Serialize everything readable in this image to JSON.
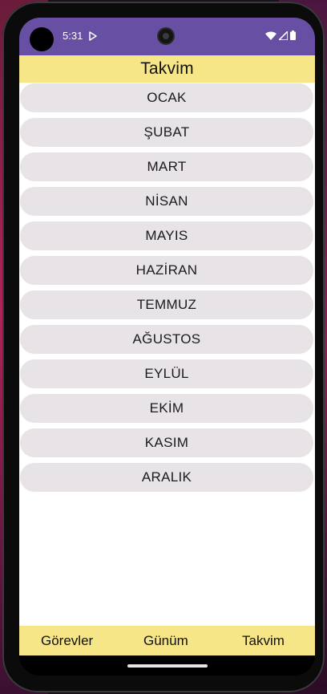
{
  "status_bar": {
    "time": "5:31",
    "icons": [
      "play-protect-icon",
      "wifi-icon",
      "signal-icon",
      "battery-icon"
    ],
    "background": "#6750a4"
  },
  "app_bar": {
    "title": "Takvim",
    "background": "#f6e687"
  },
  "months": [
    {
      "label": "OCAK"
    },
    {
      "label": "ŞUBAT"
    },
    {
      "label": "MART"
    },
    {
      "label": "NİSAN"
    },
    {
      "label": "MAYIS"
    },
    {
      "label": "HAZİRAN"
    },
    {
      "label": "TEMMUZ"
    },
    {
      "label": "AĞUSTOS"
    },
    {
      "label": "EYLÜL"
    },
    {
      "label": "EKİM"
    },
    {
      "label": "KASIM"
    },
    {
      "label": "ARALIK"
    }
  ],
  "bottom_nav": {
    "items": [
      {
        "label": "Görevler"
      },
      {
        "label": "Günüm"
      },
      {
        "label": "Takvim"
      }
    ]
  }
}
